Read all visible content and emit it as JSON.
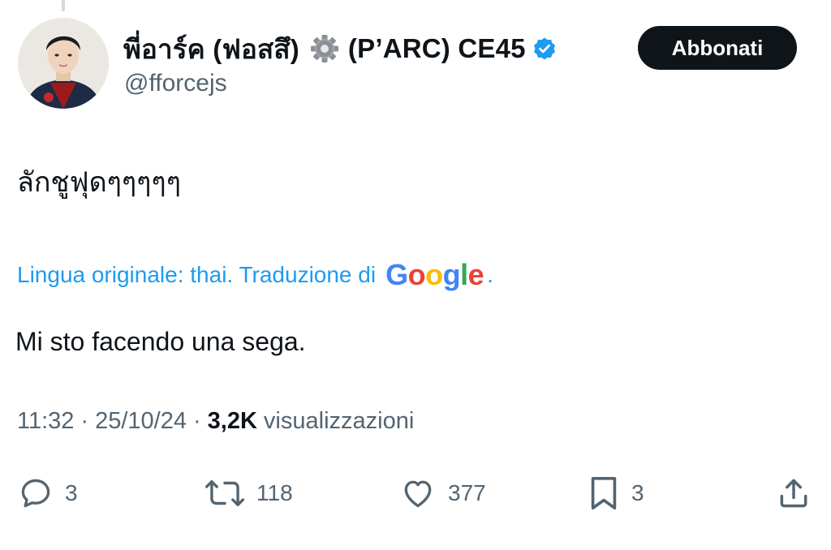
{
  "tweet": {
    "author": {
      "display_name": "พี่อาร์ค (ฟอสสึ)",
      "name_suffix": "(P’ARC) CE45",
      "name_emoji": "gear-emoji",
      "handle": "@fforcejs",
      "verified": true,
      "verified_color": "#1d9bf0"
    },
    "follow_button_label": "Abbonati",
    "text": "ลักชูฟุดๆๆๆๆๆ",
    "translation": {
      "prefix": "Lingua originale: thai. Traduzione di",
      "provider_wordmark": {
        "letters": [
          "G",
          "o",
          "o",
          "g",
          "l",
          "e"
        ],
        "colors": [
          "#4285f4",
          "#ea4335",
          "#fbbc05",
          "#4285f4",
          "#34a853",
          "#ea4335"
        ]
      },
      "suffix": ".",
      "text": "Mi sto facendo una sega."
    },
    "meta": {
      "time": "11:32",
      "date": "25/10/24",
      "separator": "·",
      "views_count": "3,2K",
      "views_label": "visualizzazioni"
    },
    "actions": {
      "reply": {
        "icon": "reply-icon",
        "count": "3"
      },
      "repost": {
        "icon": "repost-icon",
        "count": "118"
      },
      "like": {
        "icon": "heart-icon",
        "count": "377"
      },
      "bookmark": {
        "icon": "bookmark-icon",
        "count": "3"
      },
      "share": {
        "icon": "share-icon"
      }
    },
    "colors": {
      "text_primary": "#0f1419",
      "text_secondary": "#536471",
      "link": "#1d9bf0",
      "follow_button_bg": "#0f1419"
    }
  }
}
